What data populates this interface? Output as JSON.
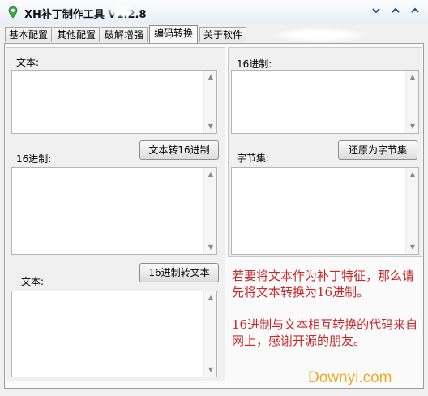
{
  "window": {
    "title": "XH补丁制作工具 V1.2.8",
    "controls": [
      "chevron-down-icon",
      "chevron-up-icon",
      "chevron-up-icon"
    ]
  },
  "tabs": [
    {
      "label": "基本配置",
      "active": false
    },
    {
      "label": "其他配置",
      "active": false
    },
    {
      "label": "破解增强",
      "active": false
    },
    {
      "label": "编码转换",
      "active": true
    },
    {
      "label": "关于软件",
      "active": false
    }
  ],
  "left": {
    "text_label_1": "文本:",
    "btn_text_to_hex": "文本转16进制",
    "hex_label": "16进制:",
    "btn_hex_to_text": "16进制转文本",
    "text_label_2": "文本:"
  },
  "right": {
    "hex_label": "16进制:",
    "btn_restore_bytes": "还原为字节集",
    "bytes_label": "字节集:"
  },
  "notice": {
    "paragraph1": "若要将文本作为补丁特征，那么请先将文本转换为16进制。",
    "paragraph2": "16进制与文本相互转换的代码来自网上，感谢开源的朋友。"
  },
  "watermark": "Downyi.com",
  "colors": {
    "notice_text": "#c8282a",
    "title_controls": "#1a4f8f",
    "watermark": "#f0a010"
  }
}
